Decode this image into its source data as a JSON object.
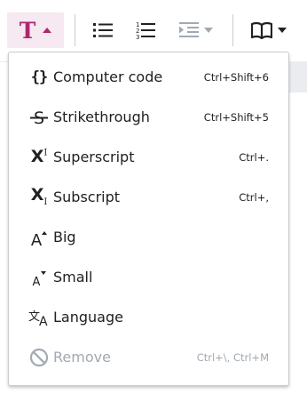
{
  "toolbar": {
    "style_icon": "text-style-icon",
    "style_glyph": "T",
    "bullet_icon": "bullet-list-icon",
    "number_icon": "numbered-list-icon",
    "indent_icon": "indent-icon",
    "cite_icon": "book-cite-icon",
    "accent_color": "#b0256f",
    "accent_bg": "#f6e9f1"
  },
  "menu": {
    "items": [
      {
        "label": "Computer code",
        "shortcut": "Ctrl+Shift+6",
        "icon": "code-braces-icon",
        "glyph": "{}",
        "disabled": false
      },
      {
        "label": "Strikethrough",
        "shortcut": "Ctrl+Shift+5",
        "icon": "strikethrough-icon",
        "glyph": "S",
        "disabled": false
      },
      {
        "label": "Superscript",
        "shortcut": "Ctrl+.",
        "icon": "superscript-icon",
        "glyph": "X",
        "glyph_sub": "I",
        "disabled": false
      },
      {
        "label": "Subscript",
        "shortcut": "Ctrl+,",
        "icon": "subscript-icon",
        "glyph": "X",
        "glyph_sub": "I",
        "disabled": false
      },
      {
        "label": "Big",
        "shortcut": "",
        "icon": "big-text-icon",
        "glyph": "A",
        "disabled": false
      },
      {
        "label": "Small",
        "shortcut": "",
        "icon": "small-text-icon",
        "glyph": "A",
        "disabled": false
      },
      {
        "label": "Language",
        "shortcut": "",
        "icon": "language-icon",
        "glyph": "文A",
        "disabled": false
      },
      {
        "label": "Remove",
        "shortcut": "Ctrl+\\, Ctrl+M",
        "icon": "remove-icon",
        "disabled": true
      }
    ]
  }
}
